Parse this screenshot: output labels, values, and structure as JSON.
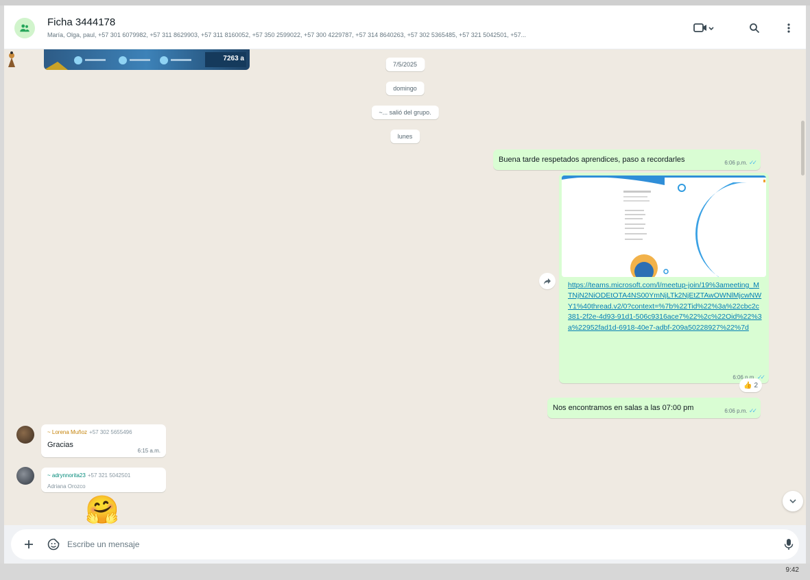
{
  "header": {
    "title": "Ficha 3444178",
    "members": "María, Olga, paul, +57 301 6079982, +57 311 8629903, +57 311 8160052, +57 350 2599022, +57 300 4229787, +57 314 8640263, +57 302 5365485, +57 321 5042501, +57..."
  },
  "top_image": {
    "label": "7263 a"
  },
  "chat": {
    "date_pill": "7/5/2025",
    "day_pill": "domingo",
    "system_notice": "~... salió del grupo.",
    "today_pill": "lunes",
    "outgoing": [
      {
        "text": "Buena tarde respetados aprendices, paso a recordarles",
        "time": "6:06 p.m."
      },
      {
        "link": "https://teams.microsoft.com/l/meetup-join/19%3ameeting_MTNjN2NiODEtOTA4NS00YmNjLTk2NjEtZTAwOWNlMjcwNWY1%40thread.v2/0?context=%7b%22Tid%22%3a%22cbc2c381-2f2e-4d93-91d1-506c9316ace7%22%2c%22Oid%22%3a%22952fad1d-6918-40e7-adbf-209a50228927%22%7d",
        "time": "6:06 p.m.",
        "reaction_emoji": "👍",
        "reaction_count": "2"
      },
      {
        "text": "Nos encontramos en salas a las 07:00 pm",
        "time": "6:06 p.m."
      }
    ],
    "incoming": [
      {
        "sender": "~ Lorena Muñoz",
        "phone": "+57 302 5655496",
        "text": "Gracias",
        "time": "6:15 a.m."
      },
      {
        "sender": "~ adrynnorita23",
        "phone": "+57 321 5042501",
        "subname": "Adriana Orozco",
        "emoji": "🤗"
      }
    ]
  },
  "composer": {
    "placeholder": "Escribe un mensaje"
  },
  "taskbar": {
    "time": "9:42"
  },
  "colors": {
    "outgoing_bubble": "#d9fdd3",
    "incoming_bubble": "#ffffff",
    "chat_bg": "#efeae2",
    "link": "#027eb5",
    "read_ticks": "#53bdeb"
  },
  "icons": [
    "group-icon",
    "video-camera-icon",
    "search-icon",
    "menu-dots-icon",
    "forward-icon",
    "chevron-down-icon",
    "plus-icon",
    "sticker-icon",
    "mic-icon"
  ]
}
